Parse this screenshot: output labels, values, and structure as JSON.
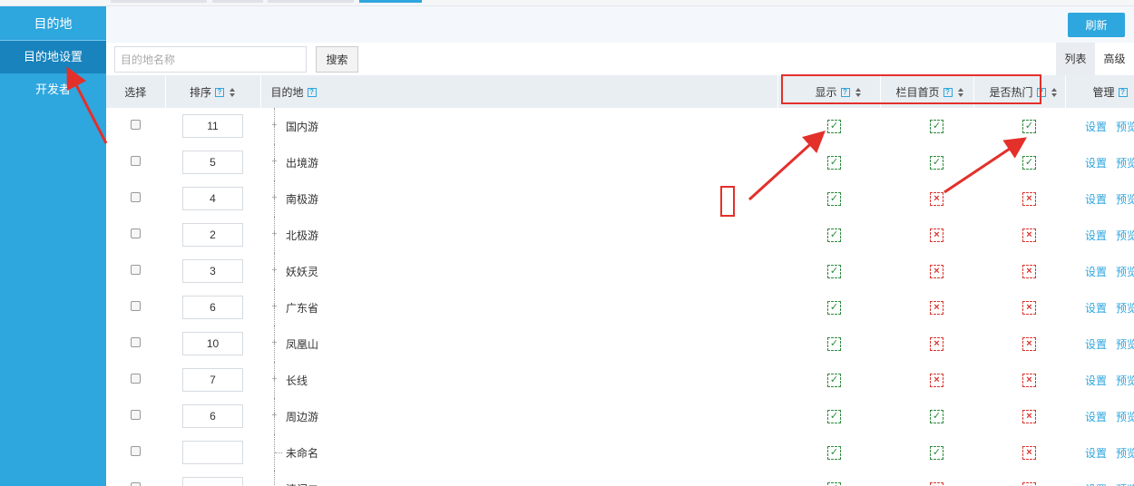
{
  "sidebar": {
    "title": "目的地",
    "items": [
      {
        "label": "目的地设置",
        "active": true
      },
      {
        "label": "开发者",
        "active": false
      }
    ]
  },
  "toolbar": {
    "refresh_label": "刷新"
  },
  "search": {
    "placeholder": "目的地名称",
    "value": "",
    "button_label": "搜索"
  },
  "view_tabs": [
    {
      "label": "列表",
      "active": true
    },
    {
      "label": "高级",
      "active": false
    }
  ],
  "table": {
    "headers": {
      "select": "选择",
      "order": "排序",
      "destination": "目的地",
      "show": "显示",
      "column_home": "栏目首页",
      "is_hot": "是否热门",
      "manage": "管理"
    },
    "help_glyph": "?",
    "rows": [
      {
        "order": "11",
        "name": "国内游",
        "show": true,
        "home": true,
        "hot": true,
        "has_children": true
      },
      {
        "order": "5",
        "name": "出境游",
        "show": true,
        "home": true,
        "hot": true,
        "has_children": true
      },
      {
        "order": "4",
        "name": "南极游",
        "show": true,
        "home": false,
        "hot": false,
        "has_children": true
      },
      {
        "order": "2",
        "name": "北极游",
        "show": true,
        "home": false,
        "hot": false,
        "has_children": true
      },
      {
        "order": "3",
        "name": "妖妖灵",
        "show": true,
        "home": false,
        "hot": false,
        "has_children": true
      },
      {
        "order": "6",
        "name": "广东省",
        "show": true,
        "home": false,
        "hot": false,
        "has_children": true
      },
      {
        "order": "10",
        "name": "凤凰山",
        "show": true,
        "home": false,
        "hot": false,
        "has_children": true
      },
      {
        "order": "7",
        "name": "长线",
        "show": true,
        "home": false,
        "hot": false,
        "has_children": true
      },
      {
        "order": "6",
        "name": "周边游",
        "show": true,
        "home": true,
        "hot": false,
        "has_children": true
      },
      {
        "order": "",
        "name": "未命名",
        "show": true,
        "home": true,
        "hot": false,
        "has_children": false
      },
      {
        "order": "",
        "name": "清门二",
        "show": true,
        "home": false,
        "hot": false,
        "has_children": false
      }
    ],
    "actions": {
      "settings": "设置",
      "preview": "预览"
    }
  },
  "status_glyphs": {
    "on": "✓",
    "off": "×"
  },
  "colors": {
    "sidebar_bg": "#2ea6de",
    "sidebar_active": "#1883bd",
    "check_on": "#2e8b3f",
    "check_off": "#d9362f",
    "annotation_red": "#e3302a"
  }
}
